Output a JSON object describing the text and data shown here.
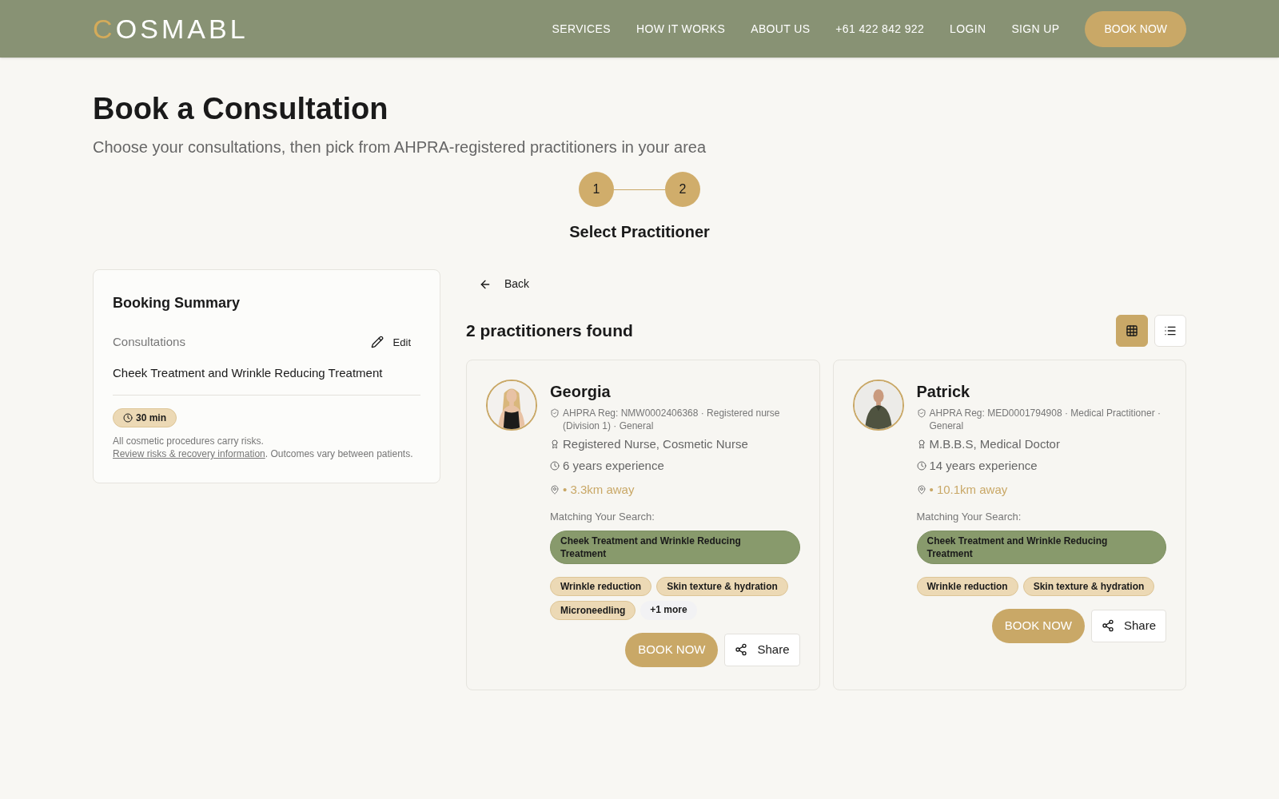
{
  "header": {
    "logo": "COSMABL",
    "nav": [
      "SERVICES",
      "HOW IT WORKS",
      "ABOUT US",
      "+61 422 842 922",
      "LOGIN",
      "SIGN UP"
    ],
    "cta": "BOOK NOW"
  },
  "page": {
    "title": "Book a Consultation",
    "subtitle": "Choose your consultations, then pick from AHPRA-registered practitioners in your area"
  },
  "stepper": {
    "steps": [
      {
        "label": "1",
        "done": true
      },
      {
        "label": "2",
        "done": true
      }
    ],
    "caption": "Select Practitioner"
  },
  "summary": {
    "title": "Booking Summary",
    "section": "Consultations",
    "edit": "Edit",
    "item": "Cheek Treatment and Wrinkle Reducing Treatment",
    "duration": "30 min",
    "notice_before": "All cosmetic procedures carry risks.",
    "notice_link": "Review risks & recovery information",
    "notice_after": ". Outcomes vary between patients."
  },
  "results": {
    "back": "Back",
    "count": "2 practitioners found",
    "views": [
      {
        "kind": "grid",
        "selected": true
      },
      {
        "kind": "list",
        "selected": false
      }
    ],
    "practitioners": [
      {
        "name": "Georgia",
        "registration": "AHPRA Reg: NMW0002406368 · Registered nurse (Division 1) · General",
        "qualifications": "Registered Nurse, Cosmetic Nurse",
        "experience": "6 years experience",
        "distance": "• 3.3km away",
        "matching_label": "Matching Your Search:",
        "match": "Cheek Treatment and Wrinkle Reducing Treatment",
        "tags": [
          "Wrinkle reduction",
          "Skin texture & hydration",
          "Microneedling"
        ],
        "more": "+1 more",
        "book": "BOOK NOW",
        "share": "Share"
      },
      {
        "name": "Patrick",
        "registration": "AHPRA Reg: MED0001794908 · Medical Practitioner · General",
        "qualifications": "M.B.B.S, Medical Doctor",
        "experience": "14 years experience",
        "distance": "• 10.1km away",
        "matching_label": "Matching Your Search:",
        "match": "Cheek Treatment and Wrinkle Reducing Treatment",
        "tags": [
          "Wrinkle reduction",
          "Skin texture & hydration"
        ],
        "book": "BOOK NOW",
        "share": "Share"
      }
    ]
  }
}
